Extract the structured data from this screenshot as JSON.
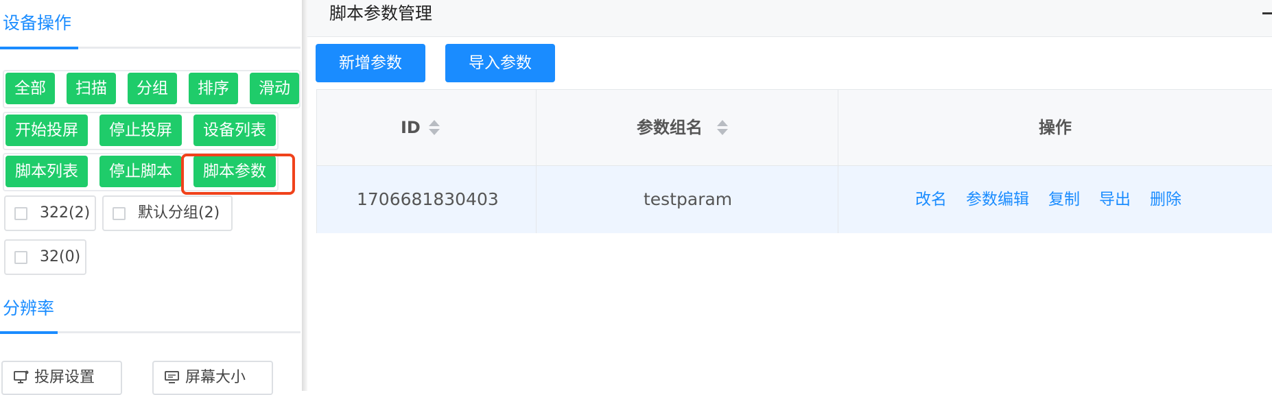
{
  "device_ops": {
    "title": "设备操作",
    "row1": [
      "全部",
      "扫描",
      "分组",
      "排序",
      "滑动"
    ],
    "row2": [
      "开始投屏",
      "停止投屏",
      "设备列表"
    ],
    "row3": [
      "脚本列表",
      "停止脚本",
      "脚本参数"
    ],
    "groups": [
      "322(2)",
      "默认分组(2)",
      "32(0)"
    ]
  },
  "resolution": {
    "title": "分辨率",
    "buttons": [
      "投屏设置",
      "屏幕大小"
    ]
  },
  "script_params": {
    "title": "脚本参数管理",
    "add_button": "新增参数",
    "import_button": "导入参数",
    "columns": [
      "ID",
      "参数组名",
      "操作"
    ],
    "rows": [
      {
        "id": "1706681830403",
        "name": "testparam",
        "actions": [
          "改名",
          "参数编辑",
          "复制",
          "导出",
          "删除"
        ]
      }
    ]
  },
  "colors": {
    "green": "#1fcc6a",
    "blue": "#1a8cff",
    "highlight": "#f0421b"
  }
}
